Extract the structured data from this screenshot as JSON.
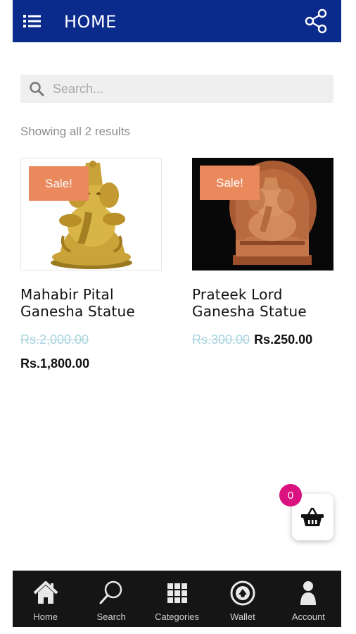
{
  "header": {
    "title": "HOME",
    "menu_icon": "list-menu-icon",
    "share_icon": "share-icon",
    "background": "#0a2a8c"
  },
  "search": {
    "placeholder": "Search...",
    "value": "",
    "icon": "search-icon"
  },
  "results": {
    "count_text": "Showing all 2 results"
  },
  "products": [
    {
      "name": "Mahabir Pital Ganesha Statue",
      "badge": "Sale!",
      "old_price": "Rs.2,000.00",
      "new_price": "Rs.1,800.00"
    },
    {
      "name": "Prateek Lord Ganesha Statue",
      "badge": "Sale!",
      "old_price": "Rs.300.00",
      "new_price": "Rs.250.00"
    }
  ],
  "cart": {
    "count": "0",
    "icon": "shopping-basket-icon",
    "badge_color": "#d9127f"
  },
  "bottom_nav": [
    {
      "label": "Home",
      "icon": "home-icon"
    },
    {
      "label": "Search",
      "icon": "search-icon"
    },
    {
      "label": "Categories",
      "icon": "grid-icon"
    },
    {
      "label": "Wallet",
      "icon": "wallet-icon"
    },
    {
      "label": "Account",
      "icon": "account-icon"
    }
  ],
  "colors": {
    "sale_badge": "#e9895c",
    "old_price": "#a6d3de",
    "nav_background": "#151515"
  }
}
